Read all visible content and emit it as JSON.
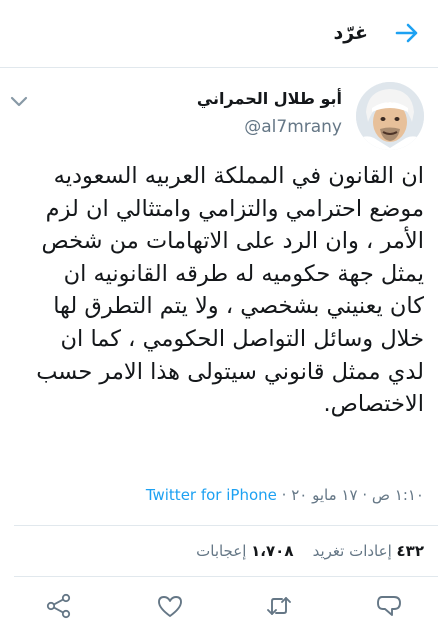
{
  "header": {
    "title": "غرّد",
    "back_icon": "arrow-right-icon",
    "accent_color": "#1da1f2"
  },
  "author": {
    "display_name": "أبو طلال الحمراني",
    "handle": "@al7mrany",
    "avatar_icon": "avatar"
  },
  "tweet": {
    "text_lines": [
      "ان القانون في المملكة العربيه السعوديه",
      "موضع احترامي والتزامي وامتثالي ان لزم",
      "الأمر ، وان الرد على الاتهامات من شخص",
      "يمثل جهة حكوميه له طرقه القانونيه ان",
      "كان يعنيني بشخصي ، ولا يتم التطرق لها",
      "خلال وسائل التواصل الحكومي ، كما ان",
      "لدي ممثل قانوني سيتولى هذا الامر حسب",
      "الاختصاص."
    ],
    "timestamp": "١:١٠ ص · ١٧ مايو ٢٠ ·",
    "source": "Twitter for iPhone"
  },
  "stats": {
    "retweets_count": "٤٣٢",
    "retweets_label": "إعادات تغريد",
    "likes_count": "١،٧٠٨",
    "likes_label": "إعجابات"
  },
  "actions": {
    "icons": [
      "reply-icon",
      "retweet-icon",
      "like-icon",
      "share-icon"
    ],
    "icon_color": "#657786"
  }
}
